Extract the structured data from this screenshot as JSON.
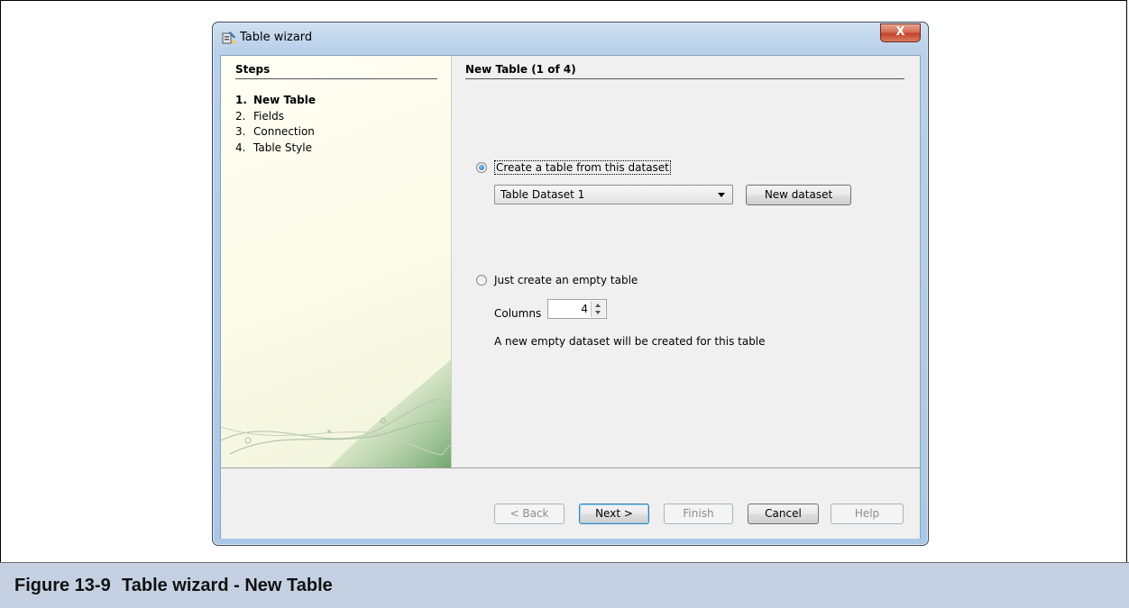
{
  "window": {
    "title": "Table wizard",
    "close_label": "X"
  },
  "steps": {
    "title": "Steps",
    "items": [
      {
        "num": "1.",
        "label": "New Table",
        "current": true
      },
      {
        "num": "2.",
        "label": "Fields"
      },
      {
        "num": "3.",
        "label": "Connection"
      },
      {
        "num": "4.",
        "label": "Table Style"
      }
    ]
  },
  "page": {
    "title": "New Table (1 of 4)",
    "option_dataset": {
      "label": "Create a table from this dataset",
      "selected": true
    },
    "dataset_select": {
      "value": "Table Dataset 1"
    },
    "new_dataset_label": "New dataset",
    "option_empty": {
      "label": "Just create an empty table",
      "selected": false
    },
    "columns_label": "Columns",
    "columns_value": "4",
    "note": "A new empty dataset will be created for this table"
  },
  "buttons": {
    "back": "< Back",
    "next": "Next >",
    "finish": "Finish",
    "cancel": "Cancel",
    "help": "Help"
  },
  "caption": {
    "number": "Figure 13-9",
    "text": "Table wizard - New Table"
  }
}
